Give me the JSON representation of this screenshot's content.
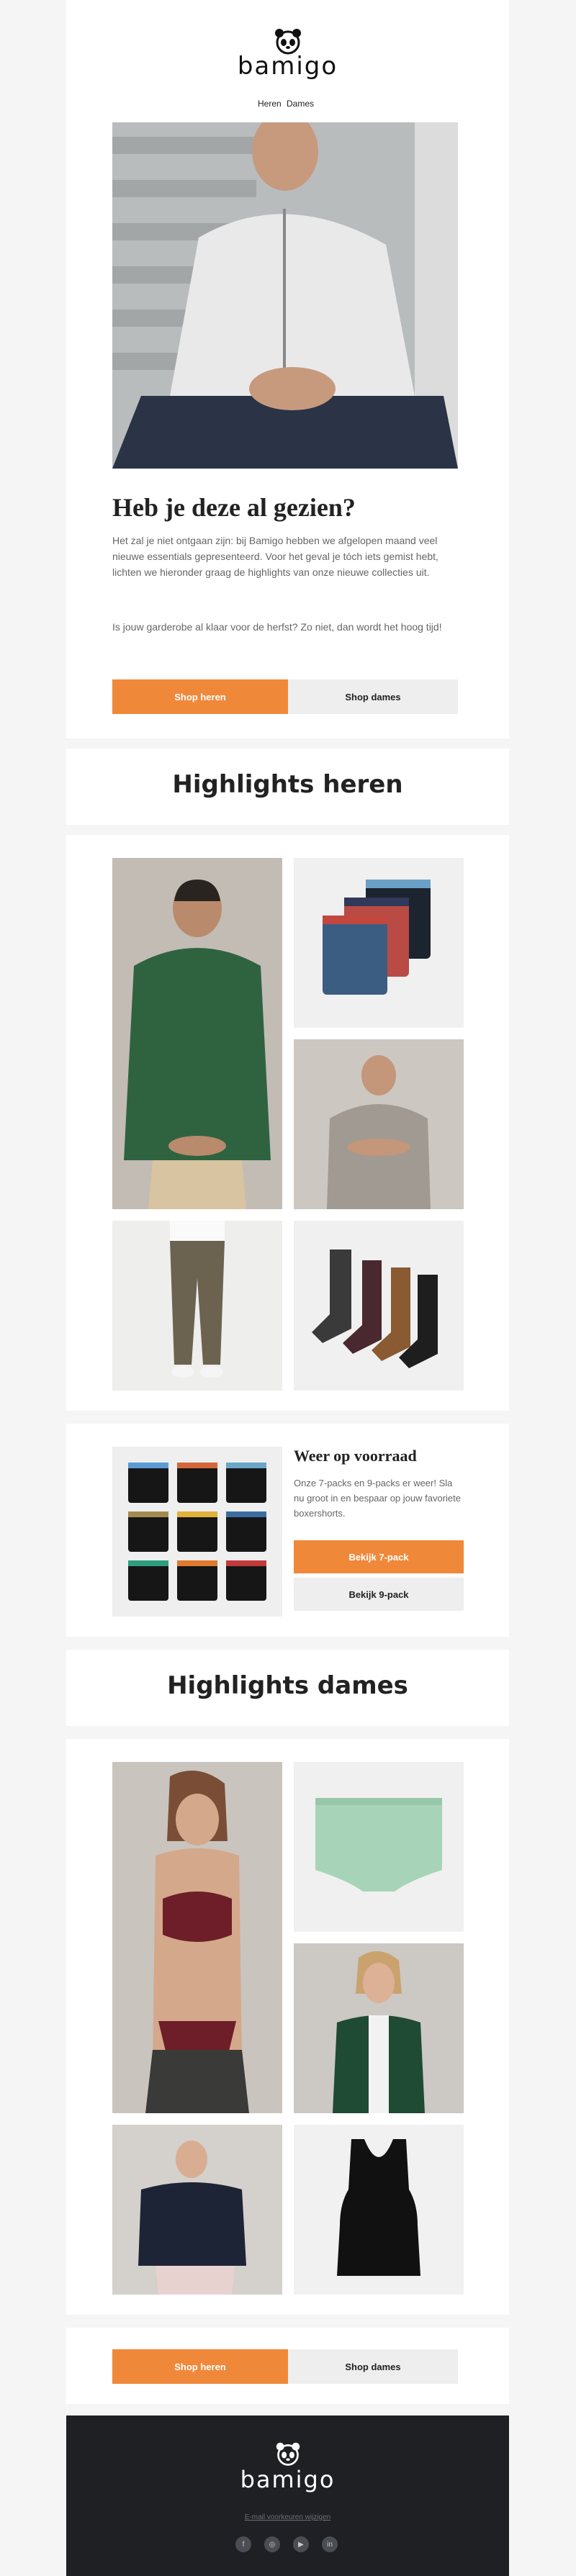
{
  "brand": {
    "name": "bamigo"
  },
  "header": {
    "nav_men": "Heren",
    "nav_women": "Dames"
  },
  "hero": {
    "title": "Heb je deze al gezien?",
    "paragraph1": "Het zal je niet ontgaan zijn: bij Bamigo hebben we afgelopen maand veel nieuwe essentials gepresenteerd. Voor het geval je tóch iets gemist hebt, lichten we hieronder graag de highlights van onze nieuwe collecties uit.",
    "paragraph2": "Is jouw garderobe al klaar voor de herfst? Zo niet, dan wordt het hoog tijd!",
    "btn_shop_men": "Shop heren",
    "btn_shop_women": "Shop dames"
  },
  "highlights_men": {
    "title": "Highlights heren"
  },
  "restock": {
    "title": "Weer op voorraad",
    "text": "Onze 7-packs en 9-packs er weer! Sla nu groot in en bespaar op jouw favoriete boxershorts.",
    "btn_7pack": "Bekijk 7-pack",
    "btn_9pack": "Bekijk 9-pack"
  },
  "highlights_women": {
    "title": "Highlights dames"
  },
  "bottom_cta": {
    "btn_shop_men": "Shop heren",
    "btn_shop_women": "Shop dames"
  },
  "footer": {
    "unsubscribe": "E-mail voorkeuren wijzigen",
    "social": [
      {
        "name": "facebook-icon",
        "glyph": "f"
      },
      {
        "name": "instagram-icon",
        "glyph": "◎"
      },
      {
        "name": "youtube-icon",
        "glyph": "▶"
      },
      {
        "name": "linkedin-icon",
        "glyph": "in"
      }
    ]
  },
  "colors": {
    "accent": "#f0883a",
    "footer_bg": "#1e2024",
    "grey_button": "#eeeeee",
    "page_bg": "#f5f5f5"
  }
}
